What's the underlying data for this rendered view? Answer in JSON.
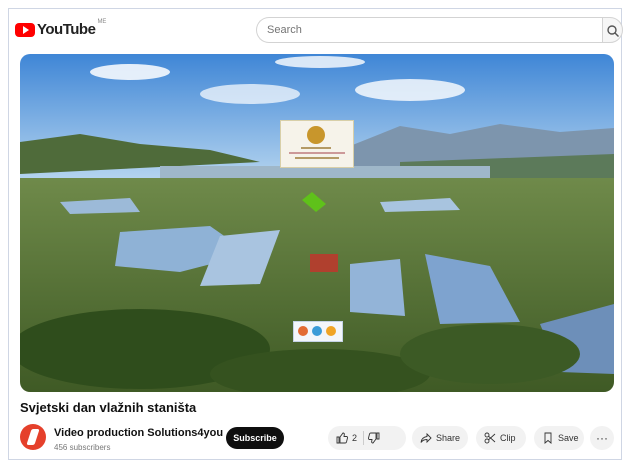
{
  "header": {
    "logo_text": "YouTube",
    "region_code": "ME",
    "search_placeholder": "Search"
  },
  "video": {
    "title": "Svjetski dan vlažnih staništa",
    "channel_name": "Video production Solutions4you",
    "subscribers": "456 subscribers"
  },
  "actions": {
    "subscribe_label": "Subscribe",
    "like_count": "2",
    "share_label": "Share",
    "clip_label": "Clip",
    "save_label": "Save",
    "more_label": "···"
  },
  "colors": {
    "brand_red": "#ff0000",
    "subscribe_bg": "#0f0f0f",
    "pill_bg": "#f2f2f2"
  },
  "icons": [
    "youtube-logo-icon",
    "search-icon",
    "like-icon",
    "dislike-icon",
    "share-icon",
    "clip-icon",
    "save-icon",
    "more-icon"
  ]
}
